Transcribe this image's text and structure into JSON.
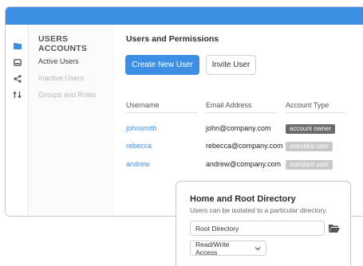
{
  "colors": {
    "accent": "#3d8fe6",
    "owner_badge": "#6b6b6b",
    "standard_badge": "#c8c8c8"
  },
  "icon_bar": [
    "folder-icon",
    "drive-icon",
    "share-icon",
    "transfer-icon"
  ],
  "sidebar": {
    "heading": "USERS ACCOUNTS",
    "items": [
      {
        "label": "Active Users",
        "state": "active"
      },
      {
        "label": "Inactive Users",
        "state": "dim"
      },
      {
        "label": "Groups and Roles",
        "state": "dim"
      }
    ]
  },
  "main": {
    "title": "Users and Permissions",
    "create_button": "Create New User",
    "invite_button": "Invite User",
    "columns": [
      "Username",
      "Email Address",
      "Account Type"
    ],
    "rows": [
      {
        "username": "johnsmith",
        "email": "john@company.com",
        "type": "account owner"
      },
      {
        "username": "rebecca",
        "email": "rebecca@company.com",
        "type": "standard user"
      },
      {
        "username": "andrew",
        "email": "andrew@company.com",
        "type": "standard user"
      }
    ]
  },
  "panel": {
    "title": "Home and Root Directory",
    "subtitle": "Users can be isolated to a particular directory.",
    "directory_placeholder": "Root Directory",
    "access_select": "Read/Write Access"
  }
}
